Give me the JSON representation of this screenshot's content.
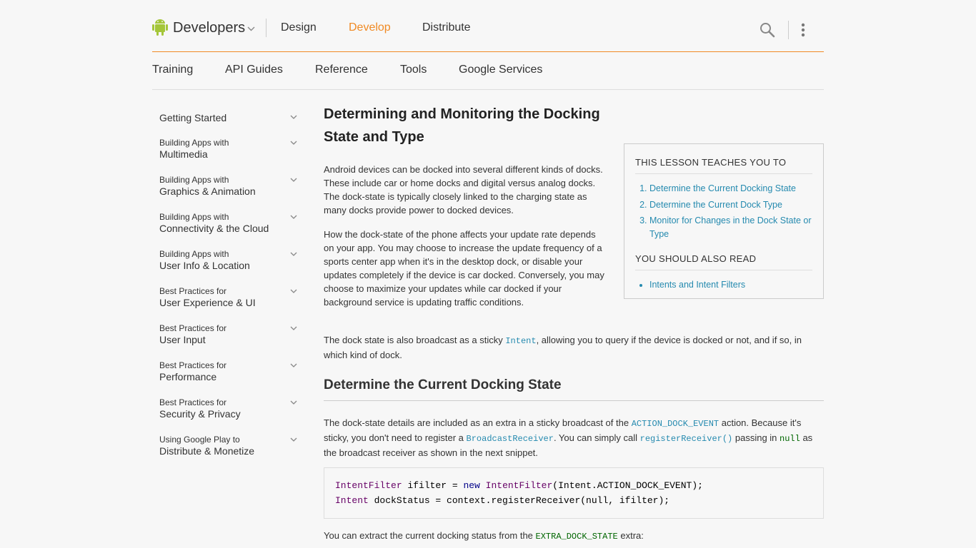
{
  "header": {
    "brand": "Developers",
    "nav": [
      {
        "label": "Design",
        "active": false
      },
      {
        "label": "Develop",
        "active": true
      },
      {
        "label": "Distribute",
        "active": false
      }
    ],
    "accent_color": "#f08a24"
  },
  "subnav": [
    "Training",
    "API Guides",
    "Reference",
    "Tools",
    "Google Services"
  ],
  "sidebar": {
    "items": [
      {
        "line1": "Getting Started",
        "line2": ""
      },
      {
        "line1": "Building Apps with",
        "line2": "Multimedia"
      },
      {
        "line1": "Building Apps with",
        "line2": "Graphics & Animation"
      },
      {
        "line1": "Building Apps with",
        "line2": "Connectivity & the Cloud"
      },
      {
        "line1": "Building Apps with",
        "line2": "User Info & Location"
      },
      {
        "line1": "Best Practices for",
        "line2": "User Experience & UI"
      },
      {
        "line1": "Best Practices for",
        "line2": "User Input"
      },
      {
        "line1": "Best Practices for",
        "line2": "Performance"
      },
      {
        "line1": "Best Practices for",
        "line2": "Security & Privacy"
      },
      {
        "line1": "Using Google Play to",
        "line2": "Distribute & Monetize"
      }
    ]
  },
  "article": {
    "title": "Determining and Monitoring the Docking State and Type",
    "p1": "Android devices can be docked into several different kinds of docks. These include car or home docks and digital versus analog docks. The dock-state is typically closely linked to the charging state as many docks provide power to docked devices.",
    "p2": "How the dock-state of the phone affects your update rate depends on your app. You may choose to increase the update frequency of a sports center app when it's in the desktop dock, or disable your updates completely if the device is car docked. Conversely, you may choose to maximize your updates while car docked if your background service is updating traffic conditions.",
    "p3_a": "The dock state is also broadcast as a sticky ",
    "p3_code": "Intent",
    "p3_b": ", allowing you to query if the device is docked or not, and if so, in which kind of dock.",
    "h2": "Determine the Current Docking State",
    "p4_a": "The dock-state details are included as an extra in a sticky broadcast of the ",
    "p4_code1": "ACTION_DOCK_EVENT",
    "p4_b": " action. Because it's sticky, you don't need to register a ",
    "p4_code2": "BroadcastReceiver",
    "p4_c": ". You can simply call ",
    "p4_code3": "registerReceiver()",
    "p4_d": " passing in ",
    "p4_code4": "null",
    "p4_e": " as the broadcast receiver as shown in the next snippet.",
    "code": {
      "l1_t1": "IntentFilter",
      "l1_t2": " ifilter = ",
      "l1_t3": "new",
      "l1_t4": " ",
      "l1_t5": "IntentFilter",
      "l1_t6": "(Intent.ACTION_DOCK_EVENT);",
      "l2_t1": "Intent",
      "l2_t2": " dockStatus = context.registerReceiver(null, ifilter);"
    },
    "p5_a": "You can extract the current docking status from the ",
    "p5_code": "EXTRA_DOCK_STATE",
    "p5_b": " extra:"
  },
  "lesson": {
    "teaches_title": "THIS LESSON TEACHES YOU TO",
    "teaches": [
      "Determine the Current Docking State",
      "Determine the Current Dock Type",
      "Monitor for Changes in the Dock State or Type"
    ],
    "read_title": "YOU SHOULD ALSO READ",
    "read": [
      "Intents and Intent Filters"
    ]
  }
}
